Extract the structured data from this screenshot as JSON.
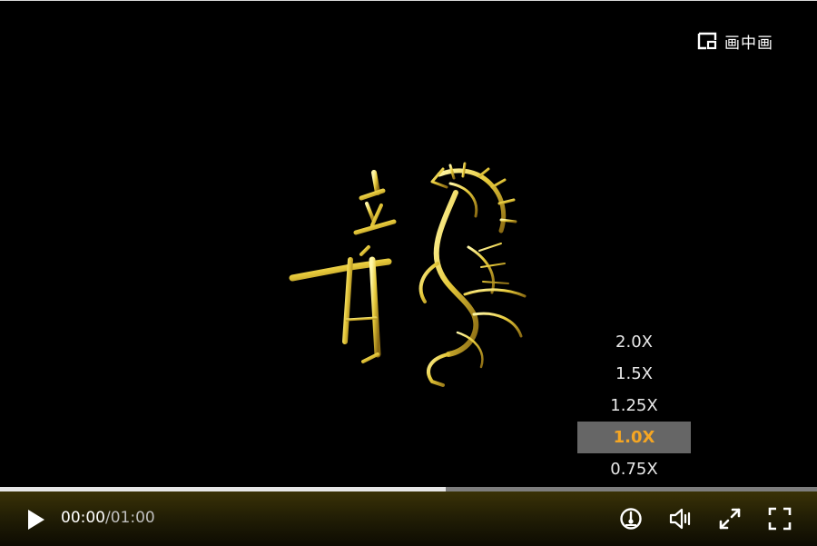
{
  "pip": {
    "label": "画中画",
    "icon": "picture-in-picture-icon"
  },
  "video": {
    "artwork": "gold-dragon-calligraphy"
  },
  "speed_menu": {
    "options": [
      "2.0X",
      "1.5X",
      "1.25X",
      "1.0X",
      "0.75X"
    ],
    "selected": "1.0X",
    "accent_color": "#f5a623"
  },
  "progress": {
    "played_fraction": 0.545
  },
  "controls": {
    "current_time": "00:00",
    "separator": "/",
    "duration": "01:00",
    "icons": [
      "play-icon",
      "speed-icon",
      "volume-icon",
      "web-fullscreen-icon",
      "fullscreen-icon"
    ]
  }
}
